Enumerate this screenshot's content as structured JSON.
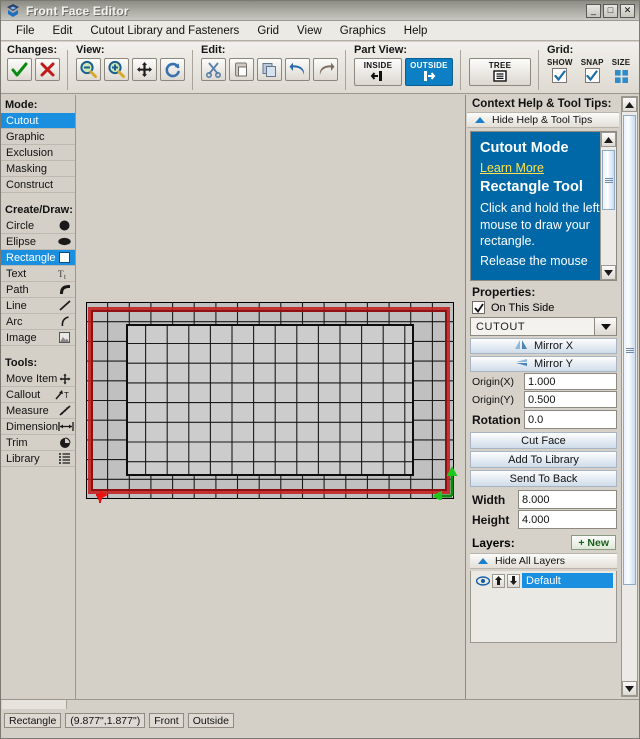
{
  "window": {
    "title": "Front Face Editor",
    "icon": "app-icon",
    "minimize": "_",
    "maximize": "□",
    "close": "✕"
  },
  "menubar": {
    "items": [
      {
        "label": "File",
        "accel": "F"
      },
      {
        "label": "Edit",
        "accel": "E"
      },
      {
        "label": "Cutout Library and Fasteners",
        "accel": "C"
      },
      {
        "label": "Grid",
        "accel": "d"
      },
      {
        "label": "View",
        "accel": "e"
      },
      {
        "label": "Graphics",
        "accel": "G"
      },
      {
        "label": "Help",
        "accel": "H"
      }
    ]
  },
  "toolbar": {
    "changes": {
      "label": "Changes:",
      "accept": "accept-check-icon",
      "cancel": "cancel-x-icon"
    },
    "view": {
      "label": "View:",
      "zoom_out": "zoom-out-icon",
      "zoom_in": "zoom-in-icon",
      "pan": "pan-move-icon",
      "refresh": "refresh-icon"
    },
    "edit": {
      "label": "Edit:",
      "cut": "scissors-cut-icon",
      "paste": "paste-icon",
      "copy": "copy-icon",
      "undo": "undo-arrow-icon",
      "redo": "redo-arrow-icon"
    },
    "part_view": {
      "label": "Part View:",
      "inside": "INSIDE",
      "outside": "OUTSIDE",
      "selected": "OUTSIDE",
      "tree": "TREE"
    },
    "grid": {
      "label": "Grid:",
      "show_label": "SHOW",
      "snap_label": "SNAP",
      "size_label": "SIZE",
      "show_checked": true,
      "snap_checked": true
    }
  },
  "sidebar": {
    "mode_header": "Mode:",
    "modes": [
      {
        "label": "Cutout",
        "selected": true
      },
      {
        "label": "Graphic",
        "selected": false
      },
      {
        "label": "Exclusion",
        "selected": false
      },
      {
        "label": "Masking",
        "selected": false
      },
      {
        "label": "Construct",
        "selected": false
      }
    ],
    "create_header": "Create/Draw:",
    "create": [
      {
        "label": "Circle",
        "icon": "circle-icon",
        "selected": false
      },
      {
        "label": "Elipse",
        "icon": "ellipse-icon",
        "selected": false
      },
      {
        "label": "Rectangle",
        "icon": "rectangle-icon",
        "selected": true
      },
      {
        "label": "Text",
        "icon": "text-icon",
        "selected": false
      },
      {
        "label": "Path",
        "icon": "path-icon",
        "selected": false
      },
      {
        "label": "Line",
        "icon": "line-icon",
        "selected": false
      },
      {
        "label": "Arc",
        "icon": "arc-icon",
        "selected": false
      },
      {
        "label": "Image",
        "icon": "image-icon",
        "selected": false
      }
    ],
    "tools_header": "Tools:",
    "tools": [
      {
        "label": "Move Item",
        "icon": "move-item-icon"
      },
      {
        "label": "Callout",
        "icon": "callout-icon"
      },
      {
        "label": "Measure",
        "icon": "measure-icon"
      },
      {
        "label": "Dimension",
        "icon": "dimension-icon"
      },
      {
        "label": "Trim",
        "icon": "trim-icon"
      },
      {
        "label": "Library",
        "icon": "library-list-icon"
      }
    ]
  },
  "right_panel": {
    "help": {
      "title": "Context Help & Tool Tips:",
      "collapse_label": "Hide Help & Tool Tips",
      "heading1": "Cutout Mode",
      "link": "Learn More",
      "heading2": "Rectangle Tool",
      "paragraph1": "Click and hold the left mouse to draw your rectangle.",
      "paragraph2": "Release the mouse"
    },
    "properties": {
      "title": "Properties:",
      "on_this_side_label": "On This Side",
      "on_this_side_checked": true,
      "type_value": "CUTOUT",
      "mirror_x": "Mirror X",
      "mirror_y": "Mirror Y",
      "origin_x_label": "Origin(X)",
      "origin_x_value": "1.000",
      "origin_y_label": "Origin(Y)",
      "origin_y_value": "0.500",
      "rotation_label": "Rotation",
      "rotation_value": "0.0",
      "cut_face": "Cut Face",
      "add_to_library": "Add To Library",
      "send_to_back": "Send To Back",
      "width_label": "Width",
      "width_value": "8.000",
      "height_label": "Height",
      "height_value": "4.000"
    },
    "layers": {
      "title": "Layers:",
      "new_button": "+ New",
      "collapse_label": "Hide All Layers",
      "rows": [
        {
          "name": "Default",
          "visible_icon": "eye-icon",
          "up_icon": "arrow-up-icon",
          "down_icon": "arrow-down-icon",
          "selected": true
        }
      ]
    }
  },
  "statusbar": {
    "tool": "Rectangle",
    "coordinates": "(9.877\",1.877\")",
    "face": "Front",
    "side": "Outside"
  },
  "colors": {
    "accent_blue": "#1a8fe0",
    "help_blue": "#0168a8",
    "selection_red": "#c22222",
    "handle_green": "#16a016",
    "link_yellow": "#ffe24d"
  },
  "canvas": {
    "grid_cols": 17,
    "grid_rows": 10,
    "selection_shape": "rectangle"
  }
}
